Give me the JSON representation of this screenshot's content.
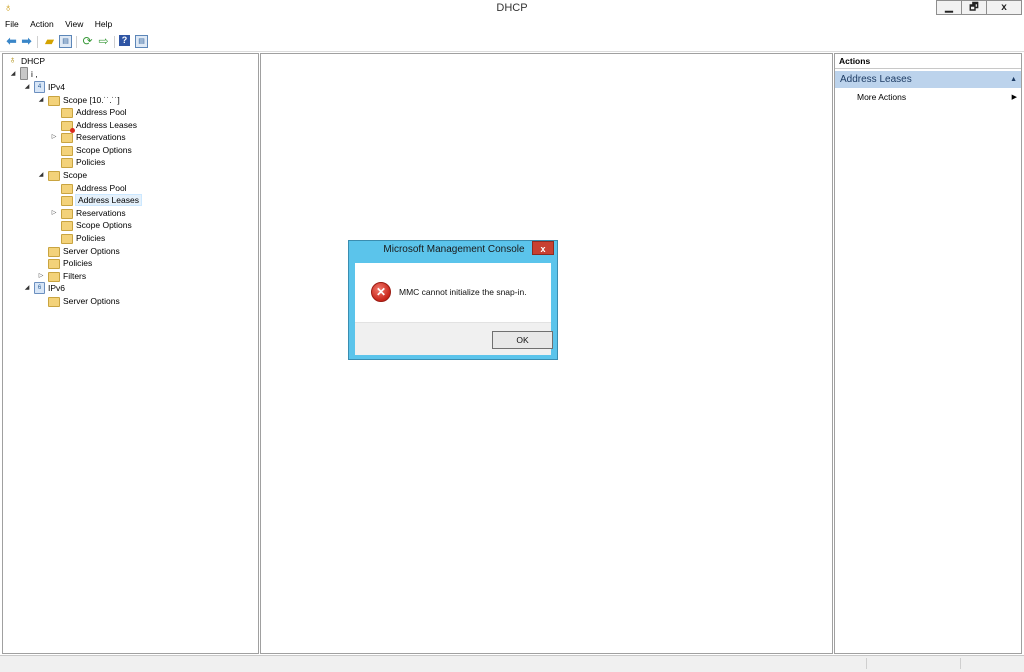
{
  "window": {
    "title": "DHCP",
    "controls": {
      "minimize": "▁",
      "restore": "🗗",
      "close": "x"
    }
  },
  "menu": {
    "items": [
      "File",
      "Action",
      "View",
      "Help"
    ]
  },
  "toolbar": {
    "icons": [
      "back-arrow-icon",
      "forward-arrow-icon",
      "up-folder-icon",
      "show-hide-console-tree-icon",
      "refresh-icon",
      "export-list-icon",
      "help-icon",
      "properties-icon"
    ]
  },
  "tree": {
    "root": "DHCP",
    "server": "i ,",
    "ipv4": "IPv4",
    "scope1": "Scope [10.˙˙.˙˙]",
    "scope1_children": [
      "Address Pool",
      "Address Leases",
      "Reservations",
      "Scope Options",
      "Policies"
    ],
    "scope2": "Scope",
    "scope2_children": [
      "Address Pool",
      "Address Leases",
      "Reservations",
      "Scope Options",
      "Policies"
    ],
    "ipv4_children": [
      "Server Options",
      "Policies",
      "Filters"
    ],
    "ipv6": "IPv6",
    "ipv6_children": [
      "Server Options"
    ]
  },
  "actions": {
    "header": "Actions",
    "section": "Address Leases",
    "items": [
      "More Actions"
    ]
  },
  "dialog": {
    "title": "Microsoft Management Console",
    "close": "x",
    "message": "MMC cannot initialize the snap-in.",
    "ok": "OK"
  },
  "colors": {
    "dialog_frame": "#5bc4eb",
    "actions_section": "#bcd3ec",
    "error": "#c8251a"
  }
}
